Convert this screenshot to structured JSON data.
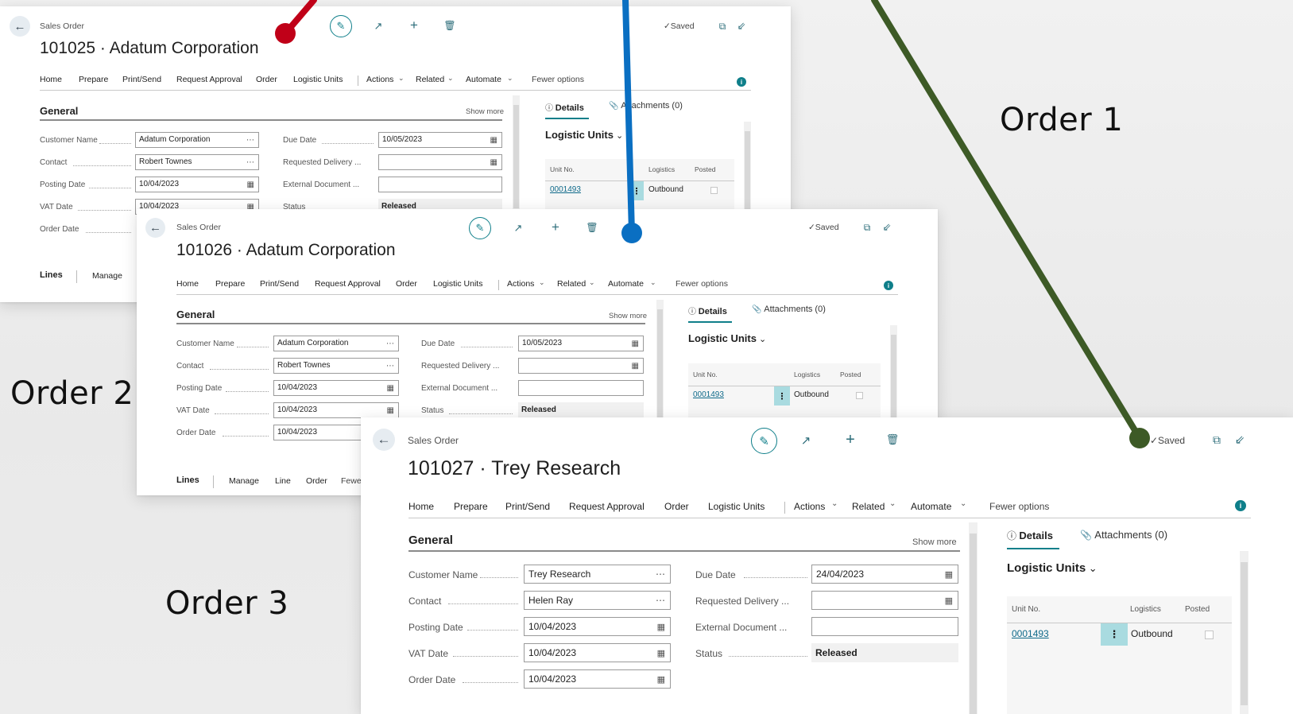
{
  "callouts": {
    "order1": "Order 1",
    "order2": "Order 2",
    "order3": "Order 3"
  },
  "colors": {
    "order1_pointer": "#c00018",
    "order2_pointer": "#0a6fc2",
    "order3_pointer": "#3d5a26",
    "accent": "#0f7f8a"
  },
  "windows": {
    "w1": {
      "kind": "Sales Order",
      "title": "101025 · Adatum Corporation",
      "saved": "✓Saved",
      "menu": [
        "Home",
        "Prepare",
        "Print/Send",
        "Request Approval",
        "Order",
        "Logistic Units",
        "Actions",
        "Related",
        "Automate",
        "Fewer options"
      ],
      "section": "General",
      "show_more": "Show more",
      "labels": {
        "customer_name": "Customer Name",
        "contact": "Contact",
        "posting_date": "Posting Date",
        "vat_date": "VAT Date",
        "order_date": "Order Date",
        "due_date": "Due Date",
        "req_delivery": "Requested Delivery ...",
        "ext_doc": "External Document ...",
        "status": "Status"
      },
      "values": {
        "customer_name": "Adatum Corporation",
        "contact": "Robert Townes",
        "posting_date": "10/04/2023",
        "vat_date": "10/04/2023",
        "due_date": "10/05/2023",
        "req_delivery": "",
        "ext_doc": "",
        "status": "Released"
      },
      "factbox": {
        "details": "Details",
        "attachments": "Attachments (0)",
        "lu_title": "Logistic Units",
        "col_unit": "Unit No.",
        "col_logistics": "Logistics",
        "col_posted": "Posted",
        "unit_no": "0001493",
        "logistics": "Outbound"
      },
      "lines": {
        "title": "Lines",
        "manage": "Manage"
      }
    },
    "w2": {
      "kind": "Sales Order",
      "title": "101026 · Adatum Corporation",
      "saved": "✓Saved",
      "menu": [
        "Home",
        "Prepare",
        "Print/Send",
        "Request Approval",
        "Order",
        "Logistic Units",
        "Actions",
        "Related",
        "Automate",
        "Fewer options"
      ],
      "section": "General",
      "show_more": "Show more",
      "labels": {
        "customer_name": "Customer Name",
        "contact": "Contact",
        "posting_date": "Posting Date",
        "vat_date": "VAT Date",
        "order_date": "Order Date",
        "due_date": "Due Date",
        "req_delivery": "Requested Delivery ...",
        "ext_doc": "External Document ...",
        "status": "Status"
      },
      "values": {
        "customer_name": "Adatum Corporation",
        "contact": "Robert Townes",
        "posting_date": "10/04/2023",
        "vat_date": "10/04/2023",
        "order_date": "10/04/2023",
        "due_date": "10/05/2023",
        "req_delivery": "",
        "ext_doc": "",
        "status": "Released"
      },
      "factbox": {
        "details": "Details",
        "attachments": "Attachments (0)",
        "lu_title": "Logistic Units",
        "col_unit": "Unit No.",
        "col_logistics": "Logistics",
        "col_posted": "Posted",
        "unit_no": "0001493",
        "logistics": "Outbound"
      },
      "lines": {
        "title": "Lines",
        "manage": "Manage",
        "line": "Line",
        "order": "Order",
        "fewer": "Fewe"
      }
    },
    "w3": {
      "kind": "Sales Order",
      "title": "101027 · Trey Research",
      "saved": "✓Saved",
      "menu": [
        "Home",
        "Prepare",
        "Print/Send",
        "Request Approval",
        "Order",
        "Logistic Units",
        "Actions",
        "Related",
        "Automate",
        "Fewer options"
      ],
      "section": "General",
      "show_more": "Show more",
      "labels": {
        "customer_name": "Customer Name",
        "contact": "Contact",
        "posting_date": "Posting Date",
        "vat_date": "VAT Date",
        "order_date": "Order Date",
        "due_date": "Due Date",
        "req_delivery": "Requested Delivery ...",
        "ext_doc": "External Document ...",
        "status": "Status"
      },
      "values": {
        "customer_name": "Trey Research",
        "contact": "Helen Ray",
        "posting_date": "10/04/2023",
        "vat_date": "10/04/2023",
        "order_date": "10/04/2023",
        "due_date": "24/04/2023",
        "req_delivery": "",
        "ext_doc": "",
        "status": "Released"
      },
      "factbox": {
        "details": "Details",
        "attachments": "Attachments (0)",
        "lu_title": "Logistic Units",
        "col_unit": "Unit No.",
        "col_logistics": "Logistics",
        "col_posted": "Posted",
        "unit_no": "0001493",
        "logistics": "Outbound"
      }
    }
  }
}
